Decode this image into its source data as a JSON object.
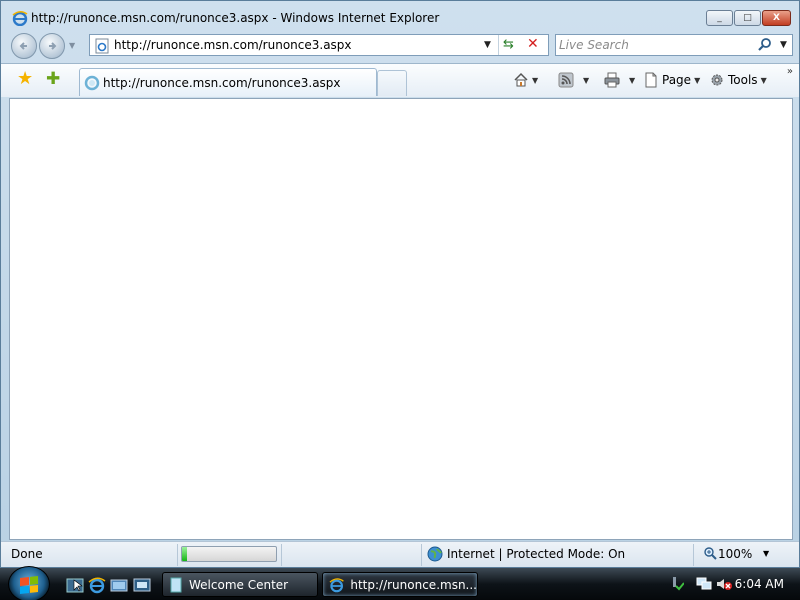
{
  "window": {
    "title": "http://runonce.msn.com/runonce3.aspx - Windows Internet Explorer",
    "minimize_glyph": "_",
    "maximize_glyph": "□",
    "close_glyph": "X"
  },
  "nav": {
    "back_icon": "back-arrow-icon",
    "forward_icon": "forward-arrow-icon",
    "address_value": "http://runonce.msn.com/runonce3.aspx",
    "search_placeholder": "Live Search"
  },
  "tabs": [
    {
      "label": "http://runonce.msn.com/runonce3.aspx",
      "active": true
    }
  ],
  "commandbar": {
    "page_label": "Page",
    "tools_label": "Tools"
  },
  "status": {
    "text": "Done",
    "progress": 0.05,
    "zone_text": "Internet | Protected Mode: On",
    "zoom": "100%"
  },
  "taskbar": {
    "tasks": [
      {
        "label": "Welcome Center",
        "active": false
      },
      {
        "label": "http://runonce.msn...",
        "active": true
      }
    ],
    "clock": "6:04 AM"
  },
  "colors": {
    "progress_fill": "#14b514",
    "close_button": "#c23d22",
    "accent": "#1e5f8e"
  }
}
